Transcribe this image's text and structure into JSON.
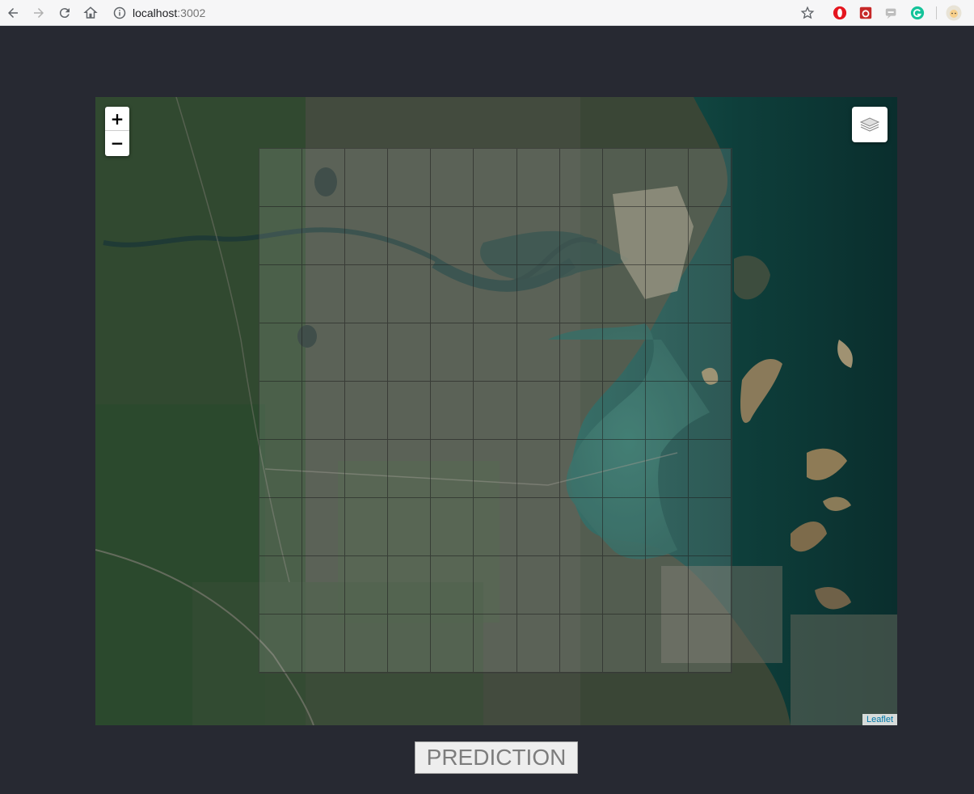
{
  "browser": {
    "url_host": "localhost",
    "url_port": ":3002",
    "icons": [
      "back-icon",
      "forward-icon",
      "reload-icon",
      "home-icon",
      "info-icon",
      "star-icon",
      "opera-ext-icon",
      "ladybug-ext-icon",
      "chat-ext-icon",
      "grammarly-ext-icon",
      "profile-avatar"
    ]
  },
  "map": {
    "zoom_in_label": "+",
    "zoom_out_label": "−",
    "attribution": "Leaflet",
    "grid": {
      "columns": 11,
      "rows": 9
    },
    "colors": {
      "water": "#0f3d3a",
      "land": "#3a4a36",
      "grid_line": "#222222"
    }
  },
  "prediction_button": {
    "label": "PREDICTION"
  },
  "colors": {
    "page_background": "#272932"
  }
}
